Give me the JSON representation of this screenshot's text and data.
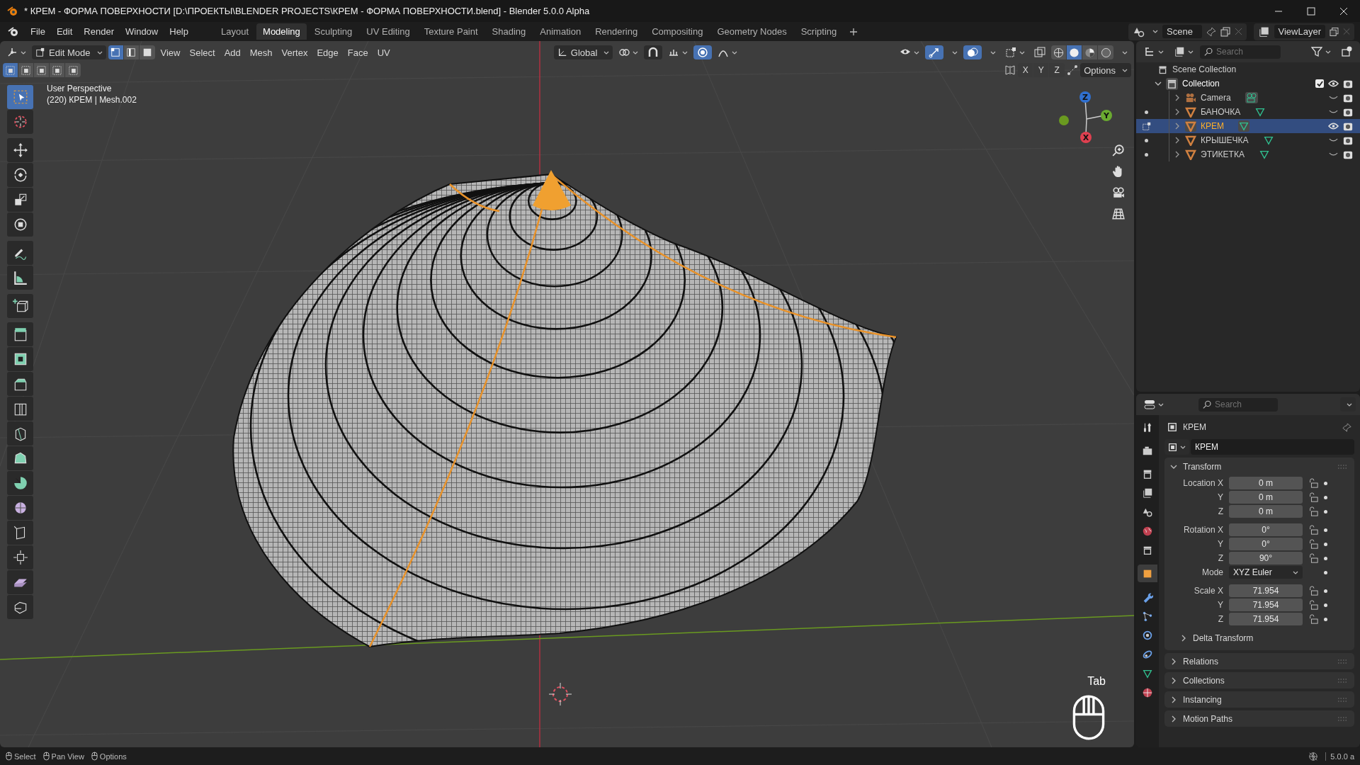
{
  "window": {
    "title": "* КРЕМ - ФОРМА ПОВЕРХНОСТИ [D:\\ПРОЕКТЫ\\BLENDER PROJECTS\\КРЕМ - ФОРМА ПОВЕРХНОСТИ.blend] - Blender 5.0.0 Alpha"
  },
  "menu": [
    "File",
    "Edit",
    "Render",
    "Window",
    "Help"
  ],
  "workspaces": [
    {
      "label": "Layout",
      "selected": false
    },
    {
      "label": "Modeling",
      "selected": true
    },
    {
      "label": "Sculpting",
      "selected": false
    },
    {
      "label": "UV Editing",
      "selected": false
    },
    {
      "label": "Texture Paint",
      "selected": false
    },
    {
      "label": "Shading",
      "selected": false
    },
    {
      "label": "Animation",
      "selected": false
    },
    {
      "label": "Rendering",
      "selected": false
    },
    {
      "label": "Compositing",
      "selected": false
    },
    {
      "label": "Geometry Nodes",
      "selected": false
    },
    {
      "label": "Scripting",
      "selected": false
    }
  ],
  "scene": {
    "name": "Scene"
  },
  "view_layer": {
    "name": "ViewLayer"
  },
  "viewport_header": {
    "mode": "Edit Mode",
    "menus": [
      "View",
      "Select",
      "Add",
      "Mesh",
      "Vertex",
      "Edge",
      "Face",
      "UV"
    ],
    "select_modes": [
      {
        "kind": "vertex",
        "selected": true
      },
      {
        "kind": "edge",
        "selected": false
      },
      {
        "kind": "face",
        "selected": false
      }
    ],
    "orientation": "Global",
    "snapping": false,
    "proportional_editing": true,
    "shading": [
      {
        "kind": "wireframe",
        "selected": false
      },
      {
        "kind": "solid",
        "selected": true
      },
      {
        "kind": "material",
        "selected": false
      },
      {
        "kind": "rendered",
        "selected": false
      }
    ],
    "axes": [
      "X",
      "Y",
      "Z"
    ],
    "options": "Options"
  },
  "viewport": {
    "perspective": "User Perspective",
    "object_info": "(220) КРЕМ | Mesh.002",
    "tool_groups": [
      {
        "tools": [
          {
            "kind": "select_box",
            "selected": true
          },
          {
            "kind": "cursor",
            "selected": false
          }
        ]
      },
      {
        "tools": [
          {
            "kind": "move",
            "selected": false
          },
          {
            "kind": "rotate",
            "selected": false
          },
          {
            "kind": "scale",
            "selected": false
          },
          {
            "kind": "transform",
            "selected": false
          }
        ]
      },
      {
        "tools": [
          {
            "kind": "annotate",
            "selected": false
          },
          {
            "kind": "measure",
            "selected": false
          }
        ]
      },
      {
        "tools": [
          {
            "kind": "add_cube",
            "selected": false
          }
        ]
      },
      {
        "tools": [
          {
            "kind": "extrude",
            "selected": false
          },
          {
            "kind": "inset",
            "selected": false
          },
          {
            "kind": "bevel",
            "selected": false
          },
          {
            "kind": "loop_cut",
            "selected": false
          },
          {
            "kind": "knife",
            "selected": false
          },
          {
            "kind": "poly_build",
            "selected": false
          },
          {
            "kind": "spin",
            "selected": false
          },
          {
            "kind": "smooth",
            "selected": false
          },
          {
            "kind": "edge_slide",
            "selected": false
          },
          {
            "kind": "shrink",
            "selected": false
          },
          {
            "kind": "shear",
            "selected": false
          },
          {
            "kind": "rip",
            "selected": false
          }
        ]
      }
    ],
    "gizmo_axes": [
      "Z",
      "Y",
      "X"
    ],
    "key_hint": "Tab"
  },
  "outliner": {
    "search": {
      "placeholder": "Search"
    },
    "scene_collection": "Scene Collection",
    "collection": {
      "name": "Collection",
      "expanded": true,
      "checked": true,
      "visible": true,
      "children": [
        {
          "name": "Camera",
          "kind": "camera",
          "selected": false,
          "visible": false,
          "edit_mode": false
        },
        {
          "name": "БАНОЧКА",
          "kind": "mesh",
          "selected": false,
          "visible": false,
          "edit_mode": false
        },
        {
          "name": "КРЕМ",
          "kind": "mesh",
          "selected": true,
          "visible": true,
          "edit_mode": true
        },
        {
          "name": "КРЫШЕЧКА",
          "kind": "mesh",
          "selected": false,
          "visible": false,
          "edit_mode": false
        },
        {
          "name": "ЭТИКЕТКА",
          "kind": "mesh",
          "selected": false,
          "visible": false,
          "edit_mode": false
        }
      ]
    }
  },
  "properties": {
    "search": {
      "placeholder": "Search"
    },
    "object_name": "КРЕМ",
    "name_field": "КРЕМ",
    "tabs": [
      {
        "kind": "tool",
        "selected": false
      },
      {
        "kind": "render",
        "selected": false
      },
      {
        "kind": "output",
        "selected": false
      },
      {
        "kind": "view_layer",
        "selected": false
      },
      {
        "kind": "scene",
        "selected": false
      },
      {
        "kind": "world",
        "selected": false
      },
      {
        "kind": "collection",
        "selected": false
      },
      {
        "kind": "object",
        "selected": true
      },
      {
        "kind": "modifiers",
        "selected": false
      },
      {
        "kind": "particles",
        "selected": false
      },
      {
        "kind": "physics",
        "selected": false
      },
      {
        "kind": "constraints",
        "selected": false
      },
      {
        "kind": "data",
        "selected": false
      },
      {
        "kind": "material",
        "selected": false
      }
    ],
    "transform": {
      "title": "Transform",
      "expanded": true,
      "groups": [
        {
          "rows": [
            {
              "label": "Location X",
              "value": "0 m",
              "kind": "number"
            },
            {
              "label": "Y",
              "value": "0 m",
              "kind": "number"
            },
            {
              "label": "Z",
              "value": "0 m",
              "kind": "number"
            }
          ]
        },
        {
          "rows": [
            {
              "label": "Rotation X",
              "value": "0°",
              "kind": "number"
            },
            {
              "label": "Y",
              "value": "0°",
              "kind": "number"
            },
            {
              "label": "Z",
              "value": "90°",
              "kind": "number"
            },
            {
              "label": "Mode",
              "value": "XYZ Euler",
              "kind": "dropdown"
            }
          ]
        },
        {
          "rows": [
            {
              "label": "Scale X",
              "value": "71.954",
              "kind": "number"
            },
            {
              "label": "Y",
              "value": "71.954",
              "kind": "number"
            },
            {
              "label": "Z",
              "value": "71.954",
              "kind": "number"
            }
          ]
        }
      ],
      "subpanel": "Delta Transform"
    },
    "panels": [
      "Relations",
      "Collections",
      "Instancing",
      "Motion Paths"
    ]
  },
  "status_bar": {
    "hints": [
      "Select",
      "Pan View",
      "Options"
    ],
    "version": "5.0.0 a"
  }
}
